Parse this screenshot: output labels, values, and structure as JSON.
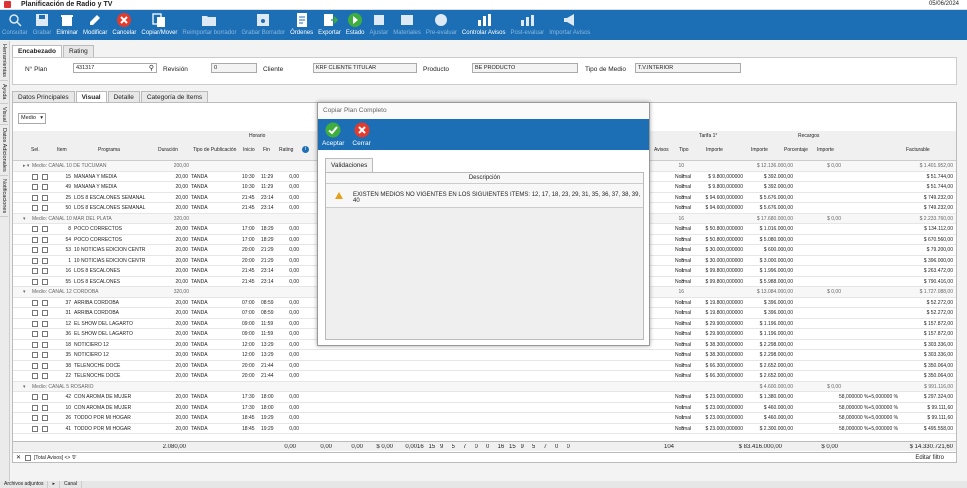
{
  "app": {
    "title": "Planificación de Radio y TV",
    "date": "05/06/2024"
  },
  "toolbar": [
    {
      "label": "Consultar",
      "icon": "search-icon",
      "enabled": false
    },
    {
      "label": "Grabar",
      "icon": "save-icon",
      "enabled": false
    },
    {
      "label": "Eliminar",
      "icon": "delete-icon",
      "enabled": true
    },
    {
      "label": "Modificar",
      "icon": "edit-icon",
      "enabled": true
    },
    {
      "label": "Cancelar",
      "icon": "cancel-icon",
      "enabled": true
    },
    {
      "label": "Copiar/Mover",
      "icon": "copy-icon",
      "enabled": true
    },
    {
      "label": "Reimportar borrador",
      "icon": "folder-icon",
      "enabled": false
    },
    {
      "label": "Grabar Borrador",
      "icon": "save-draft-icon",
      "enabled": false
    },
    {
      "label": "Órdenes",
      "icon": "orders-icon",
      "enabled": true
    },
    {
      "label": "Exportar",
      "icon": "export-icon",
      "enabled": true
    },
    {
      "label": "Estado",
      "icon": "status-icon",
      "enabled": true
    },
    {
      "label": "Ajustar",
      "icon": "adjust-icon",
      "enabled": false
    },
    {
      "label": "Materiales",
      "icon": "materials-icon",
      "enabled": false
    },
    {
      "label": "Pre-evaluar",
      "icon": "pre-evaluate-icon",
      "enabled": false
    },
    {
      "label": "Controlar Avisos",
      "icon": "chart-icon",
      "enabled": true
    },
    {
      "label": "Post-evaluar",
      "icon": "post-evaluate-icon",
      "enabled": false
    },
    {
      "label": "Importar Avisos",
      "icon": "megaphone-icon",
      "enabled": false
    }
  ],
  "side_tabs": [
    "Herramientas",
    "Ayuda",
    "Visual",
    "Datos Adicionales",
    "Notificaciones"
  ],
  "tabs": [
    "Encabezado",
    "Rating"
  ],
  "header": {
    "plan_label": "N° Plan",
    "plan_value": "431317",
    "revision_label": "Revisión",
    "revision_value": "0",
    "cliente_label": "Cliente",
    "cliente_value": "KRF CLIENTE TITULAR",
    "producto_label": "Producto",
    "producto_value": "BE PRODUCTO",
    "tipo_label": "Tipo de Medio",
    "tipo_value": "T.V.INTERIOR"
  },
  "subtabs": [
    "Datos Principales",
    "Visual",
    "Detalle",
    "Categoría de Items"
  ],
  "grid": {
    "combo": "Medio",
    "columns": {
      "sel": "Sel.",
      "item": "Item",
      "programa": "Programa",
      "duracion": "Duración",
      "tipo_pub": "Tipo de Publicación",
      "horario": "Horario",
      "inicio": "Inicio",
      "fin": "Fin",
      "rating": "Rating",
      "tarifa": "Tarifa 1°",
      "tipo": "Tipo",
      "importe": "Importe",
      "importe2": "Importe",
      "recargos": "Recargos",
      "porcentaje": "Porcentaje",
      "importe3": "Importe",
      "facturable": "Facturable",
      "avisos": "Avisos"
    },
    "groups": [
      {
        "label": "Medio: CANAL 10 DE TUCUMAN",
        "duracion": "200,00",
        "avisos": "10",
        "importe2": "$ 12.136.000,00",
        "recargo": "$ 0,00",
        "facturable": "$ 1.401.952,00",
        "rows": [
          {
            "item": "15",
            "programa": "MAÑANA Y MEDIA",
            "dur": "20,00",
            "tipo_pub": "TANDA",
            "ini": "10:30",
            "fin": "11:29",
            "rating": "0,00",
            "avisos": "2",
            "tipo": "Normal",
            "importe": "$ 9.800,000000",
            "importe2": "$ 392.000,00",
            "facturable": "$ 51.744,00"
          },
          {
            "item": "49",
            "programa": "MAÑANA Y MEDIA",
            "dur": "20,00",
            "tipo_pub": "TANDA",
            "ini": "10:30",
            "fin": "11:29",
            "rating": "0,00",
            "avisos": "2",
            "tipo": "Normal",
            "importe": "$ 9.800,000000",
            "importe2": "$ 392.000,00",
            "facturable": "$ 51.744,00"
          },
          {
            "item": "25",
            "programa": "LOS 8 ESCALONES SEMANAL",
            "dur": "20,00",
            "tipo_pub": "TANDA",
            "ini": "21:45",
            "fin": "23:14",
            "rating": "0,00",
            "avisos": "3",
            "tipo": "Normal",
            "importe": "$ 94.600,000000",
            "importe2": "$ 5.676.000,00",
            "facturable": "$ 749.232,00"
          },
          {
            "item": "50",
            "programa": "LOS 8 ESCALONES SEMANAL",
            "dur": "20,00",
            "tipo_pub": "TANDA",
            "ini": "21:45",
            "fin": "23:14",
            "rating": "0,00",
            "avisos": "3",
            "tipo": "Normal",
            "importe": "$ 94.600,000000",
            "importe2": "$ 5.676.000,00",
            "facturable": "$ 749.232,00"
          }
        ]
      },
      {
        "label": "Medio: CANAL 10 MAR DEL PLATA",
        "duracion": "320,00",
        "avisos": "16",
        "importe2": "$ 17.680.000,00",
        "recargo": "$ 0,00",
        "facturable": "$ 2.233.760,00",
        "rows": [
          {
            "item": "8",
            "programa": "POCO CORRECTOS",
            "dur": "20,00",
            "tipo_pub": "TANDA",
            "ini": "17:00",
            "fin": "18:29",
            "rating": "0,00",
            "avisos": "2",
            "tipo": "Normal",
            "importe": "$ 50.800,000000",
            "importe2": "$ 1.016.000,00",
            "facturable": "$ 134.112,00"
          },
          {
            "item": "54",
            "programa": "POCO CORRECTOS",
            "dur": "20,00",
            "tipo_pub": "TANDA",
            "ini": "17:00",
            "fin": "18:29",
            "rating": "0,00",
            "avisos": "5",
            "tipo": "Normal",
            "importe": "$ 50.800,000000",
            "importe2": "$ 5.080.000,00",
            "facturable": "$ 670.560,00"
          },
          {
            "item": "53",
            "programa": "10 NOTICIAS EDICION CENTR",
            "dur": "20,00",
            "tipo_pub": "TANDA",
            "ini": "20:00",
            "fin": "21:29",
            "rating": "0,00",
            "avisos": "1",
            "tipo": "Normal",
            "importe": "$ 30.000,000000",
            "importe2": "$ 600.000,00",
            "facturable": "$ 79.200,00"
          },
          {
            "item": "1",
            "programa": "10 NOTICIAS EDICION CENTR",
            "dur": "20,00",
            "tipo_pub": "TANDA",
            "ini": "20:00",
            "fin": "21:29",
            "rating": "0,00",
            "avisos": "5",
            "tipo": "Normal",
            "importe": "$ 30.000,000000",
            "importe2": "$ 3.000.000,00",
            "facturable": "$ 396.000,00"
          },
          {
            "item": "16",
            "programa": "LOS 8 ESCALONES",
            "dur": "20,00",
            "tipo_pub": "TANDA",
            "ini": "21:45",
            "fin": "23:14",
            "rating": "0,00",
            "avisos": "1",
            "tipo": "Normal",
            "importe": "$ 99.800,000000",
            "importe2": "$ 1.996.000,00",
            "facturable": "$ 263.472,00"
          },
          {
            "item": "55",
            "programa": "LOS 8 ESCALONES",
            "dur": "20,00",
            "tipo_pub": "TANDA",
            "ini": "21:45",
            "fin": "23:14",
            "rating": "0,00",
            "avisos": "3",
            "tipo": "Normal",
            "importe": "$ 99.800,000000",
            "importe2": "$ 5.988.000,00",
            "facturable": "$ 790.416,00"
          }
        ]
      },
      {
        "label": "Medio: CANAL 12   CORDOBA",
        "duracion": "320,00",
        "avisos": "16",
        "importe2": "$ 13.084.000,00",
        "recargo": "$ 0,00",
        "facturable": "$ 1.727.088,00",
        "rows": [
          {
            "item": "37",
            "programa": "ARRIBA CORDOBA",
            "dur": "20,00",
            "tipo_pub": "TANDA",
            "ini": "07:00",
            "fin": "08:59",
            "rating": "0,00",
            "avisos": "1",
            "tipo": "Normal",
            "importe": "$ 19.800,000000",
            "importe2": "$ 396.000,00",
            "facturable": "$ 52.272,00"
          },
          {
            "item": "31",
            "programa": "ARRIBA CORDOBA",
            "dur": "20,00",
            "tipo_pub": "TANDA",
            "ini": "07:00",
            "fin": "08:59",
            "rating": "0,00",
            "avisos": "1",
            "tipo": "Normal",
            "importe": "$ 19.800,000000",
            "importe2": "$ 396.000,00",
            "facturable": "$ 52.272,00"
          },
          {
            "item": "12",
            "programa": "EL SHOW DEL LAGARTO",
            "dur": "20,00",
            "tipo_pub": "TANDA",
            "ini": "09:00",
            "fin": "11:59",
            "rating": "0,00",
            "avisos": "2",
            "tipo": "Normal",
            "importe": "$ 29.900,000000",
            "importe2": "$ 1.196.000,00",
            "facturable": "$ 157.872,00"
          },
          {
            "item": "36",
            "programa": "EL SHOW DEL LAGARTO",
            "dur": "20,00",
            "tipo_pub": "TANDA",
            "ini": "09:00",
            "fin": "11:59",
            "rating": "0,00",
            "avisos": "2",
            "tipo": "Normal",
            "importe": "$ 29.900,000000",
            "importe2": "$ 1.196.000,00",
            "facturable": "$ 157.872,00"
          },
          {
            "item": "18",
            "programa": "NOTICIERO 12",
            "dur": "20,00",
            "tipo_pub": "TANDA",
            "ini": "12:00",
            "fin": "13:29",
            "rating": "0,00",
            "avisos": "3",
            "tipo": "Normal",
            "importe": "$ 38.300,000000",
            "importe2": "$ 2.298.000,00",
            "facturable": "$ 303.336,00"
          },
          {
            "item": "35",
            "programa": "NOTICIERO 12",
            "dur": "20,00",
            "tipo_pub": "TANDA",
            "ini": "12:00",
            "fin": "13:29",
            "rating": "0,00",
            "avisos": "3",
            "tipo": "Normal",
            "importe": "$ 38.300,000000",
            "importe2": "$ 2.298.000,00",
            "facturable": "$ 303.336,00"
          },
          {
            "item": "38",
            "programa": "TELENOCHE DOCE",
            "dur": "20,00",
            "tipo_pub": "TANDA",
            "ini": "20:00",
            "fin": "21:44",
            "rating": "0,00",
            "avisos": "2",
            "tipo": "Normal",
            "importe": "$ 66.300,000000",
            "importe2": "$ 2.652.000,00",
            "facturable": "$ 350.064,00"
          },
          {
            "item": "22",
            "programa": "TELENOCHE DOCE",
            "dur": "20,00",
            "tipo_pub": "TANDA",
            "ini": "20:00",
            "fin": "21:44",
            "rating": "0,00",
            "avisos": "2",
            "tipo": "Normal",
            "importe": "$ 66.300,000000",
            "importe2": "$ 2.652.000,00",
            "facturable": "$ 350.064,00"
          }
        ]
      },
      {
        "label": "Medio: CANAL 5 ROSARIO",
        "duracion": "",
        "avisos": "",
        "importe2": "$ 4.600.000,00",
        "recargo": "$ 0,00",
        "facturable": "$ 991.116,00",
        "rows": [
          {
            "item": "42",
            "programa": "CON AROMA DE MUJER",
            "dur": "20,00",
            "tipo_pub": "TANDA",
            "ini": "17:30",
            "fin": "18:00",
            "rating": "0,00",
            "avisos": "3",
            "tipo": "Normal",
            "importe": "$ 23.000,000000",
            "importe2": "$ 1.380.000,00",
            "pct": "58,000000 %+5,000000 %",
            "facturable": "$ 297.324,00"
          },
          {
            "item": "10",
            "programa": "CON AROMA DE MUJER",
            "dur": "20,00",
            "tipo_pub": "TANDA",
            "ini": "17:30",
            "fin": "18:00",
            "rating": "0,00",
            "avisos": "1",
            "tipo": "Normal",
            "importe": "$ 23.000,000000",
            "importe2": "$ 460.000,00",
            "pct": "58,000000 %+5,000000 %",
            "facturable": "$ 99.111,60"
          },
          {
            "item": "26",
            "programa": "TODDO POR MI HOGAR",
            "dur": "20,00",
            "tipo_pub": "TANDA",
            "ini": "18:45",
            "fin": "19:29",
            "rating": "0,00",
            "avisos": "1",
            "tipo": "Normal",
            "importe": "$ 23.000,000000",
            "importe2": "$ 460.000,00",
            "pct": "58,000000 %+5,000000 %",
            "facturable": "$ 99.111,60"
          },
          {
            "item": "41",
            "programa": "TODDO POR MI HOGAR",
            "dur": "20,00",
            "tipo_pub": "TANDA",
            "ini": "18:45",
            "fin": "19:29",
            "rating": "0,00",
            "avisos": "5",
            "tipo": "Normal",
            "importe": "$ 23.000,000000",
            "importe2": "$ 2.300.000,00",
            "pct": "58,000000 %+5,000000 %",
            "facturable": "$ 495.558,00"
          }
        ]
      }
    ],
    "totals": {
      "duracion": "2.080,00",
      "rating": "0,00",
      "v1": "0,00",
      "v2": "0,00",
      "v3": "$ 0,00",
      "v4": "0,00",
      "days": [
        "16",
        "15",
        "9",
        "5",
        "7",
        "0",
        "0",
        "16",
        "15",
        "9",
        "5",
        "7",
        "0",
        "0"
      ],
      "avisos": "104",
      "importe2": "$ 83.416.000,00",
      "recargo": "$ 0,00",
      "facturable": "$ 14.330.721,60"
    },
    "filter_text": "[Total Avisos] <> '0'",
    "edit_filter": "Editar filtro"
  },
  "dialog": {
    "title": "Copiar Plan Completo",
    "accept": "Aceptar",
    "close": "Cerrar",
    "tab": "Validaciones",
    "col_header": "Descripción",
    "message": "EXISTEN MEDIOS NO VIGENTES EN LOS SIGUIENTES ITEMS: 12, 17, 18, 23, 29, 31, 35, 36, 37, 38, 39, 40"
  },
  "bottom": [
    "Archivos adjuntos",
    "▸",
    "Canal"
  ]
}
